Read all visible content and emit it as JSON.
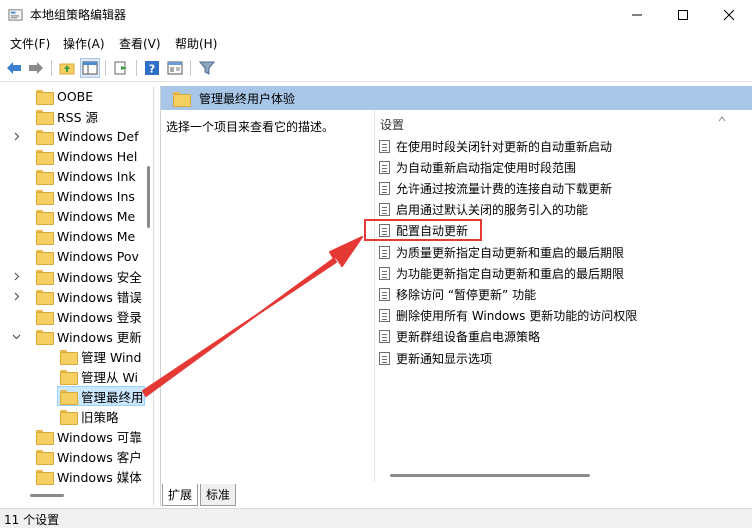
{
  "window": {
    "title": "本地组策略编辑器",
    "controls": [
      "minimize-icon",
      "maximize-icon",
      "close-icon"
    ]
  },
  "menubar": {
    "items": [
      "文件(F)",
      "操作(A)",
      "查看(V)",
      "帮助(H)"
    ]
  },
  "toolbar": {
    "icons": [
      "back-arrow-icon",
      "forward-arrow-icon",
      "up-folder-icon",
      "show-hide-tree-icon",
      "export-list-icon",
      "help-icon",
      "properties-icon",
      "filter-icon"
    ]
  },
  "tree": {
    "items": [
      {
        "label": "OOBE",
        "expanded": false,
        "has_children": false
      },
      {
        "label": "RSS 源",
        "expanded": false,
        "has_children": false
      },
      {
        "label": "Windows Def",
        "expanded": false,
        "has_children": true
      },
      {
        "label": "Windows Hel",
        "expanded": false,
        "has_children": false
      },
      {
        "label": "Windows Ink",
        "expanded": false,
        "has_children": false
      },
      {
        "label": "Windows Ins",
        "expanded": false,
        "has_children": false
      },
      {
        "label": "Windows Me",
        "expanded": false,
        "has_children": false
      },
      {
        "label": "Windows Me",
        "expanded": false,
        "has_children": false
      },
      {
        "label": "Windows Pov",
        "expanded": false,
        "has_children": false
      },
      {
        "label": "Windows 安全",
        "expanded": false,
        "has_children": true
      },
      {
        "label": "Windows 错误",
        "expanded": false,
        "has_children": true
      },
      {
        "label": "Windows 登录",
        "expanded": false,
        "has_children": false
      },
      {
        "label": "Windows 更新",
        "expanded": true,
        "has_children": true
      },
      {
        "label": "管理 Wind",
        "child": true
      },
      {
        "label": "管理从 Wi",
        "child": true
      },
      {
        "label": "管理最终用",
        "child": true,
        "selected": true
      },
      {
        "label": "旧策略",
        "child": true
      },
      {
        "label": "Windows 可靠",
        "expanded": false,
        "has_children": false
      },
      {
        "label": "Windows 客户",
        "expanded": false,
        "has_children": false
      },
      {
        "label": "Windows 媒体",
        "expanded": false,
        "has_children": false
      }
    ]
  },
  "pane": {
    "header_title": "管理最终用户体验",
    "description": "选择一个项目来查看它的描述。",
    "list_header": "设置",
    "settings": [
      "在使用时段关闭针对更新的自动重新启动",
      "为自动重新启动指定使用时段范围",
      "允许通过按流量计费的连接自动下载更新",
      "启用通过默认关闭的服务引入的功能",
      "配置自动更新",
      "为质量更新指定自动更新和重启的最后期限",
      "为功能更新指定自动更新和重启的最后期限",
      "移除访问 “暂停更新” 功能",
      "删除使用所有 Windows 更新功能的访问权限",
      "更新群组设备重启电源策略",
      "更新通知显示选项"
    ],
    "highlighted_index": 4,
    "tabs": [
      "扩展",
      "标准"
    ]
  },
  "status": {
    "text": "11 个设置"
  },
  "colors": {
    "header_blue": "#a8c6e8",
    "selection": "#cce8ff",
    "highlight_red": "#e53935"
  }
}
